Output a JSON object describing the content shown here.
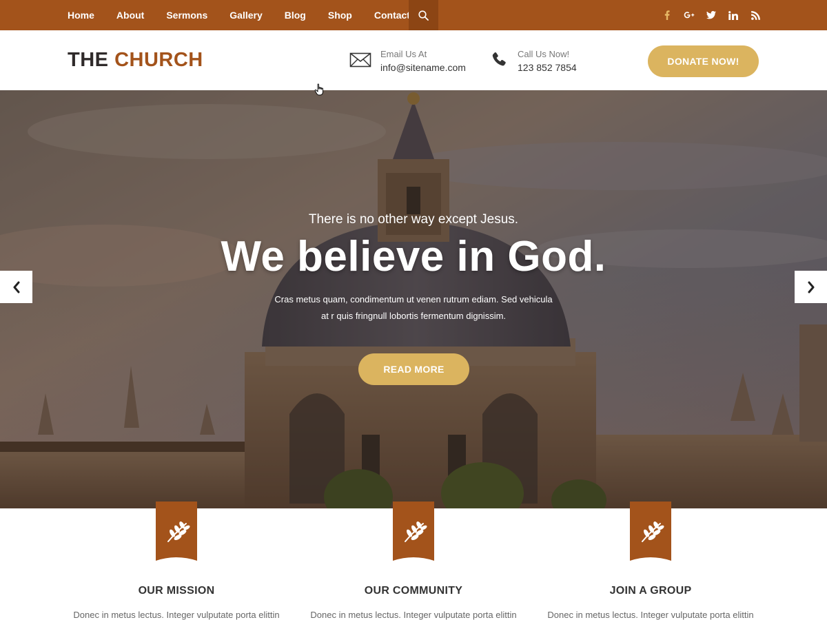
{
  "nav": {
    "items": [
      "Home",
      "About",
      "Sermons",
      "Gallery",
      "Blog",
      "Shop",
      "Contact"
    ],
    "search_icon": "search-icon"
  },
  "social": {
    "facebook": "f",
    "googleplus": "g+",
    "twitter": "t",
    "linkedin": "in",
    "rss": "rss"
  },
  "header": {
    "logo_part1": "THE",
    "logo_part2": "CHURCH",
    "email_label": "Email Us At",
    "email_value": "info@sitename.com",
    "phone_label": "Call Us Now!",
    "phone_value": "123 852 7854",
    "donate_label": "DONATE NOW!"
  },
  "hero": {
    "kicker": "There is no other way except Jesus.",
    "title": "We believe in God.",
    "text_line1": "Cras metus quam, condimentum ut venen rutrum ediam. Sed vehicula",
    "text_line2": "at r quis fringnull lobortis fermentum dignissim.",
    "button_label": "READ MORE"
  },
  "features": [
    {
      "title": "OUR MISSION",
      "text": "Donec in metus lectus. Integer vulputate porta elittin"
    },
    {
      "title": "OUR COMMUNITY",
      "text": "Donec in metus lectus. Integer vulputate porta elittin"
    },
    {
      "title": "JOIN A GROUP",
      "text": "Donec in metus lectus. Integer vulputate porta elittin"
    }
  ],
  "colors": {
    "brand": "#a3531b",
    "accent": "#dbb45f"
  }
}
